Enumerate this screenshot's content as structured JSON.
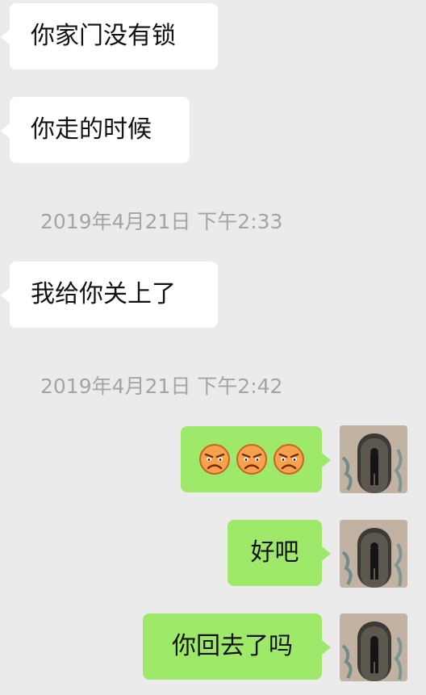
{
  "messages": [
    {
      "type": "in",
      "text": "你家门没有锁"
    },
    {
      "type": "in",
      "text": "你走的时候"
    },
    {
      "type": "time",
      "text": "2019年4月21日 下午2:33"
    },
    {
      "type": "in",
      "text": "我给你关上了"
    },
    {
      "type": "time",
      "text": "2019年4月21日 下午2:42"
    },
    {
      "type": "out",
      "emoji": [
        "angry-face-icon",
        "angry-face-icon",
        "angry-face-icon"
      ]
    },
    {
      "type": "out",
      "text": "好吧"
    },
    {
      "type": "out",
      "text": "你回去了吗"
    }
  ],
  "colors": {
    "background": "#ebebeb",
    "incoming_bubble": "#ffffff",
    "outgoing_bubble": "#9ee96a",
    "timestamp": "#a4a4a4"
  }
}
